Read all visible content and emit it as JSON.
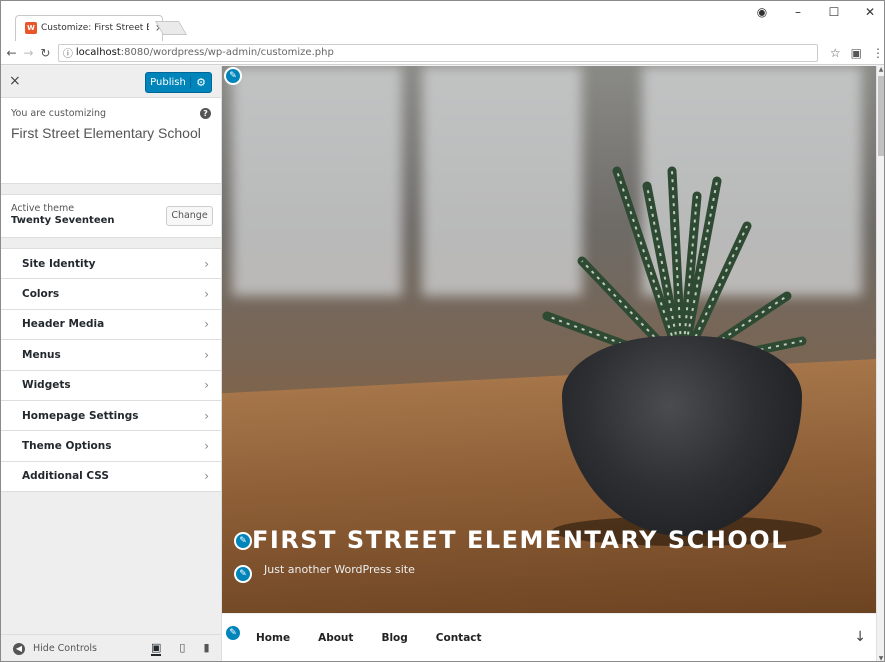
{
  "browser": {
    "tab_title": "Customize: First Street El",
    "tab_close": "×",
    "url_host": "localhost",
    "url_path": ":8080/wordpress/wp-admin/customize.php",
    "window_controls": [
      "–",
      "☐",
      "✕"
    ],
    "profile_icon": "profile-icon"
  },
  "sidebar": {
    "close": "×",
    "publish_label": "Publish",
    "customizing_label": "You are customizing",
    "site_title": "First Street Elementary School",
    "theme_label": "Active theme",
    "theme_name": "Twenty Seventeen",
    "change_label": "Change",
    "items": [
      {
        "label": "Site Identity"
      },
      {
        "label": "Colors"
      },
      {
        "label": "Header Media"
      },
      {
        "label": "Menus"
      },
      {
        "label": "Widgets"
      },
      {
        "label": "Homepage Settings"
      },
      {
        "label": "Theme Options"
      },
      {
        "label": "Additional CSS"
      }
    ],
    "hide_controls": "Hide Controls"
  },
  "preview": {
    "site_title": "FIRST STREET ELEMENTARY SCHOOL",
    "tagline": "Just another WordPress site",
    "nav": [
      "Home",
      "About",
      "Blog",
      "Contact"
    ]
  },
  "colors": {
    "accent": "#0085ba"
  }
}
